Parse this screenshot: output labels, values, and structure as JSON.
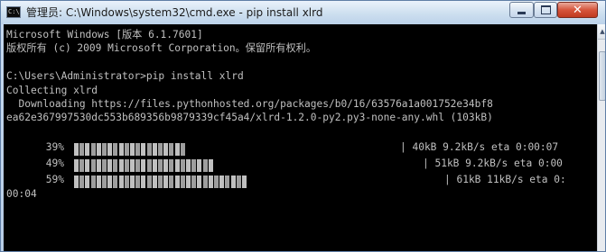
{
  "window": {
    "title": "管理员: C:\\Windows\\system32\\cmd.exe - pip  install xlrd",
    "icon_text": "C:\\",
    "buttons": {
      "minimize": "minimize",
      "maximize": "maximize",
      "close": "✕"
    }
  },
  "console": {
    "lines": [
      "Microsoft Windows [版本 6.1.7601]",
      "版权所有 (c) 2009 Microsoft Corporation。保留所有权利。",
      "",
      "C:\\Users\\Administrator>pip install xlrd",
      "Collecting xlrd",
      "  Downloading https://files.pythonhosted.org/packages/b0/16/63576a1a001752e34bf8",
      "ea62e367997530dc553b689356b9879339cf45a4/xlrd-1.2.0-py2.py3-none-any.whl (103kB)"
    ],
    "progress": [
      {
        "percent_label": "39%",
        "fraction": 0.39,
        "info": "| 40kB 9.2kB/s eta 0:00:07"
      },
      {
        "percent_label": "49%",
        "fraction": 0.49,
        "info": "| 51kB 9.2kB/s eta 0:00"
      },
      {
        "percent_label": "59%",
        "fraction": 0.59,
        "info": "| 61kB 11kB/s eta 0:"
      }
    ],
    "wrapped_line": "00:04"
  },
  "colors": {
    "console_bg": "#000000",
    "console_text": "#c0c0c0",
    "close_button": "#d6553c"
  },
  "icons": {
    "app": "console-icon",
    "scroll_up": "scroll-up-arrow-icon"
  }
}
